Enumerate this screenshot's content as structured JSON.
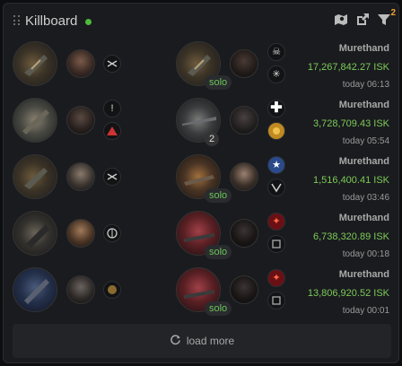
{
  "header": {
    "title": "Killboard",
    "icons": [
      "map-icon",
      "external-link-icon",
      "filter-icon"
    ],
    "filter_count": "2"
  },
  "kills": [
    {
      "pilot": "Murethand",
      "value": "17,267,842.27 ISK",
      "time": "today 06:13",
      "badge": "solo"
    },
    {
      "pilot": "Murethand",
      "value": "3,728,709.43 ISK",
      "time": "today 05:54",
      "badge": "2"
    },
    {
      "pilot": "Murethand",
      "value": "1,516,400.41 ISK",
      "time": "today 03:46",
      "badge": "solo"
    },
    {
      "pilot": "Murethand",
      "value": "6,738,320.89 ISK",
      "time": "today 00:18",
      "badge": "solo"
    },
    {
      "pilot": "Murethand",
      "value": "13,806,920.52 ISK",
      "time": "today 00:01",
      "badge": "solo"
    }
  ],
  "load_more_label": "load more",
  "colors": {
    "accent_green": "#7ccb5a",
    "live_dot": "#4cbb3a",
    "filter_badge": "#f0a030"
  }
}
